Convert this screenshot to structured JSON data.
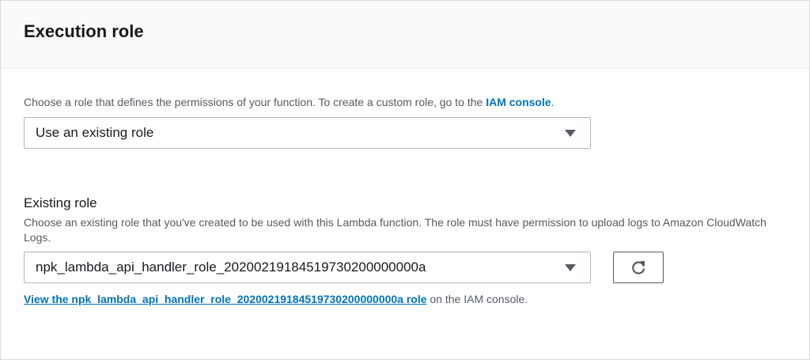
{
  "section": {
    "title": "Execution role"
  },
  "role_type": {
    "description_prefix": "Choose a role that defines the permissions of your function. To create a custom role, go to the ",
    "iam_link": "IAM console",
    "description_suffix": ".",
    "selected": "Use an existing role",
    "caret_icon": "caret-down-icon"
  },
  "existing_role": {
    "label": "Existing role",
    "description": "Choose an existing role that you've created to be used with this Lambda function. The role must have permission to upload logs to Amazon CloudWatch Logs.",
    "selected": "npk_lambda_api_handler_role_20200219184519730200000000a",
    "refresh_icon": "refresh-icon",
    "view_link": "View the npk_lambda_api_handler_role_20200219184519730200000000a role",
    "view_suffix": " on the IAM console."
  },
  "colors": {
    "link": "#0073bb",
    "header_bg": "#fafafa",
    "border": "#d5dbdb",
    "text": "#16191f",
    "secondary_text": "#545b64"
  }
}
